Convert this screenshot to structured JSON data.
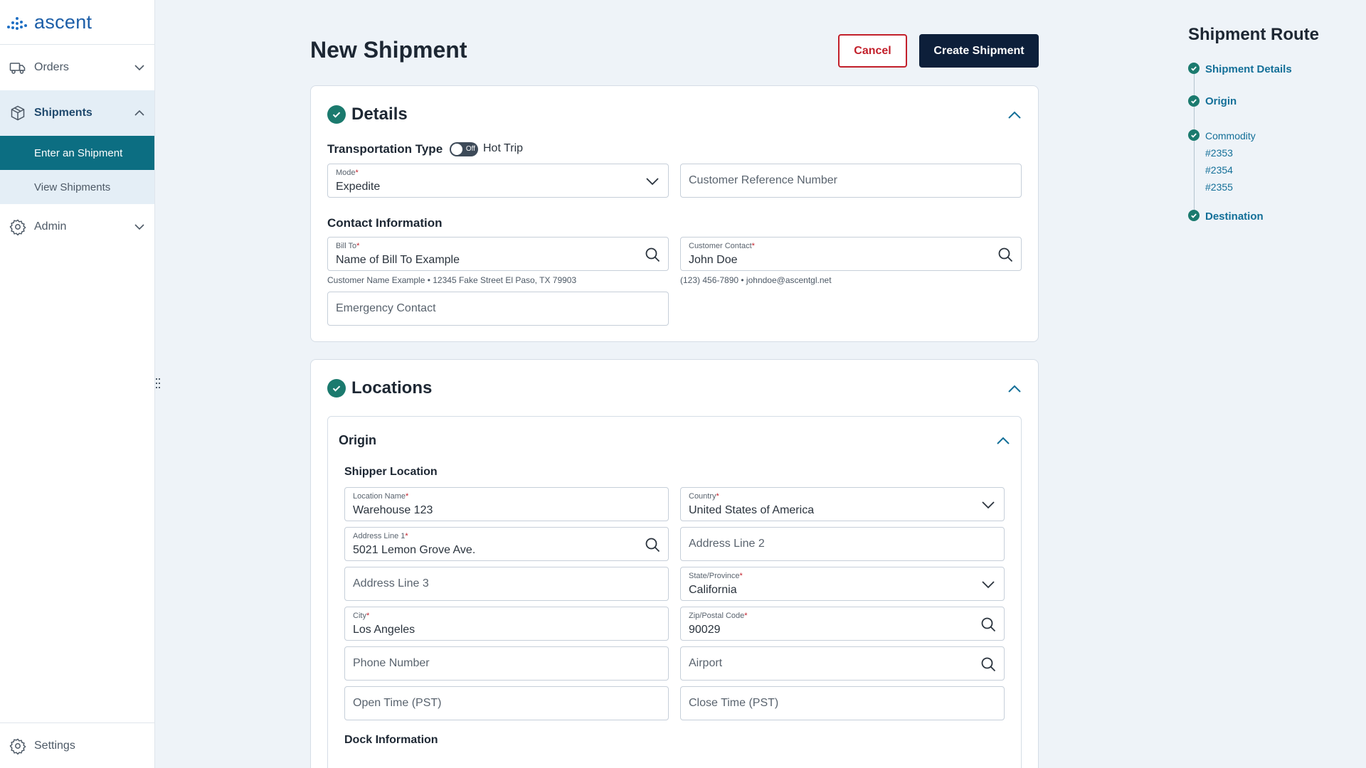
{
  "app": {
    "logo_text": "ascent"
  },
  "sidebar": {
    "items": [
      {
        "label": "Orders",
        "icon": "truck-icon"
      },
      {
        "label": "Shipments",
        "icon": "package-icon"
      },
      {
        "label": "Admin",
        "icon": "gear-icon"
      }
    ],
    "shipments_sub": [
      {
        "label": "Enter an Shipment"
      },
      {
        "label": "View Shipments"
      }
    ],
    "settings_label": "Settings"
  },
  "header": {
    "title": "New Shipment",
    "cancel_label": "Cancel",
    "create_label": "Create Shipment"
  },
  "details": {
    "title": "Details",
    "transportation_type_label": "Transportation Type",
    "toggle_state": "Off",
    "hot_trip_label": "Hot Trip",
    "mode": {
      "label": "Mode",
      "value": "Expedite"
    },
    "customer_reference_placeholder": "Customer Reference Number",
    "contact_title": "Contact Information",
    "bill_to": {
      "label": "Bill To",
      "value": "Name of Bill To Example",
      "helper": "Customer Name Example • 12345 Fake Street El Paso, TX 79903"
    },
    "customer_contact": {
      "label": "Customer Contact",
      "value": "John Doe",
      "helper": "(123) 456-7890 • johndoe@ascentgl.net"
    },
    "emergency_contact_placeholder": "Emergency Contact"
  },
  "locations": {
    "title": "Locations",
    "origin_title": "Origin",
    "shipper_location_title": "Shipper Location",
    "location_name": {
      "label": "Location Name",
      "value": "Warehouse 123"
    },
    "country": {
      "label": "Country",
      "value": "United States of America"
    },
    "address1": {
      "label": "Address Line 1",
      "value": "5021 Lemon Grove Ave."
    },
    "address2_placeholder": "Address Line 2",
    "address3_placeholder": "Address Line 3",
    "state": {
      "label": "State/Province",
      "value": "California"
    },
    "city": {
      "label": "City",
      "value": "Los Angeles"
    },
    "zip": {
      "label": "Zip/Postal Code",
      "value": "90029"
    },
    "phone_placeholder": "Phone Number",
    "airport_placeholder": "Airport",
    "open_time_placeholder": "Open Time (PST)",
    "close_time_placeholder": "Close Time (PST)",
    "dock_title": "Dock Information"
  },
  "route": {
    "title": "Shipment Route",
    "shipment_details": "Shipment Details",
    "origin": "Origin",
    "commodity": "Commodity",
    "commodities": [
      "#2353",
      "#2354",
      "#2355"
    ],
    "destination": "Destination"
  },
  "colors": {
    "primary": "#0d1f3a",
    "accent_teal": "#0c6e82",
    "success": "#1b7a6e",
    "danger": "#c21f2a",
    "link": "#136f98"
  }
}
